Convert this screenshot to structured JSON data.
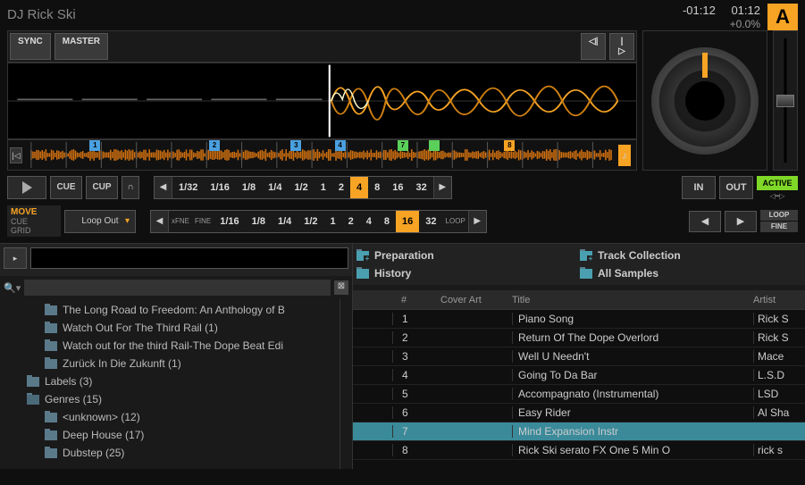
{
  "deck": {
    "artist": "DJ Rick Ski",
    "remaining": "-01:12",
    "elapsed": "01:12",
    "tempo": "+0.0%",
    "letter": "A"
  },
  "sync_row": {
    "sync": "SYNC",
    "master": "MASTER",
    "prev": "◁|",
    "next": "|▷"
  },
  "cue_markers": [
    {
      "n": "1",
      "color": "#4aa0e0",
      "pos": 13
    },
    {
      "n": "2",
      "color": "#4aa0e0",
      "pos": 32
    },
    {
      "n": "3",
      "color": "#4aa0e0",
      "pos": 45
    },
    {
      "n": "4",
      "color": "#4aa0e0",
      "pos": 52
    },
    {
      "n": "7",
      "color": "#5ad05a",
      "pos": 62
    },
    {
      "n": "",
      "color": "#5ad05a",
      "pos": 67
    },
    {
      "n": "8",
      "color": "#f7a324",
      "pos": 79
    }
  ],
  "transport": {
    "cue": "CUE",
    "cup": "CUP",
    "flux": "∩",
    "loop_values": [
      "1/32",
      "1/16",
      "1/8",
      "1/4",
      "1/2",
      "1",
      "2",
      "4",
      "8",
      "16",
      "32"
    ],
    "loop_active_index": 7,
    "in": "IN",
    "out": "OUT",
    "active": "ACTIVE"
  },
  "move": {
    "title": "MOVE",
    "cue": "CUE",
    "grid": "GRID",
    "mode": "Loop Out",
    "xfine": "xFNE",
    "fine": "FINE",
    "values": [
      "1/16",
      "1/8",
      "1/4",
      "1/2",
      "1",
      "2",
      "4",
      "8",
      "16",
      "32"
    ],
    "active_index": 8,
    "loop_lbl": "LOOP",
    "loop": "LOOP",
    "fine2": "FINE"
  },
  "folders": {
    "preparation": "Preparation",
    "track_collection": "Track Collection",
    "history": "History",
    "all_samples": "All Samples"
  },
  "tree": [
    {
      "label": "The Long Road to Freedom: An Anthology of B",
      "indent": 2,
      "open": false
    },
    {
      "label": "Watch Out For The Third Rail (1)",
      "indent": 2,
      "open": false
    },
    {
      "label": "Watch out for the third Rail-The Dope Beat Edi",
      "indent": 2,
      "open": false
    },
    {
      "label": "Zurück In Die Zukunft (1)",
      "indent": 2,
      "open": false
    },
    {
      "label": "Labels (3)",
      "indent": 1,
      "open": false
    },
    {
      "label": "Genres (15)",
      "indent": 1,
      "open": true
    },
    {
      "label": "<unknown> (12)",
      "indent": 3,
      "open": false
    },
    {
      "label": "Deep House (17)",
      "indent": 3,
      "open": false
    },
    {
      "label": "Dubstep (25)",
      "indent": 3,
      "open": false
    }
  ],
  "table": {
    "headers": {
      "num": "#",
      "art": "Cover Art",
      "title": "Title",
      "artist": "Artist"
    },
    "rows": [
      {
        "n": "1",
        "title": "Piano Song",
        "artist": "Rick S"
      },
      {
        "n": "2",
        "title": "Return Of The Dope Overlord",
        "artist": "Rick S"
      },
      {
        "n": "3",
        "title": "Well U Needn't",
        "artist": "Mace"
      },
      {
        "n": "4",
        "title": "Going To Da Bar",
        "artist": "L.S.D"
      },
      {
        "n": "5",
        "title": "Accompagnato (Instrumental)",
        "artist": "LSD"
      },
      {
        "n": "6",
        "title": "Easy Rider",
        "artist": "Al Sha"
      },
      {
        "n": "7",
        "title": "Mind Expansion Instr",
        "artist": ""
      },
      {
        "n": "8",
        "title": "Rick Ski serato FX One 5 Min O",
        "artist": "rick s"
      }
    ],
    "selected_index": 6
  }
}
